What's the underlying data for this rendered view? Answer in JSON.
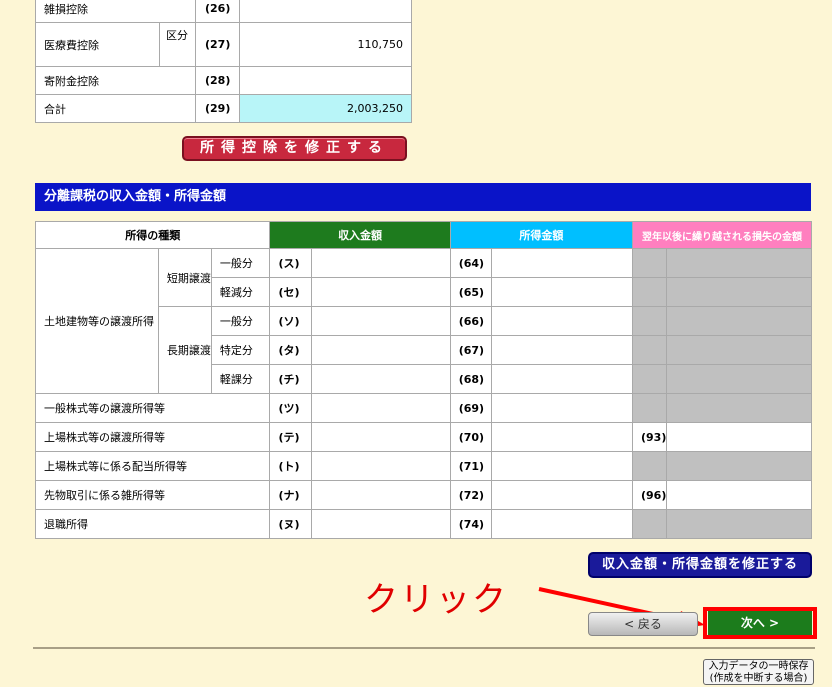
{
  "deductions": {
    "rows": [
      {
        "label": "雑損控除",
        "num": "(26)",
        "amount": ""
      },
      {
        "label": "医療費控除",
        "sub": "区分",
        "num": "(27)",
        "amount": "110,750"
      },
      {
        "label": "寄附金控除",
        "num": "(28)",
        "amount": ""
      },
      {
        "label": "合計",
        "num": "(29)",
        "amount": "2,003,250"
      }
    ],
    "modify_button": "所得控除を修正する"
  },
  "separate": {
    "title": "分離課税の収入金額・所得金額",
    "headers": {
      "kind": "所得の種類",
      "income": "収入金額",
      "shotoku": "所得金額",
      "loss": "翌年以後に繰り越される損失の金額"
    },
    "colors": {
      "income": "#1e7b1e",
      "shotoku": "#00bfff",
      "loss": "#ff7fbf"
    },
    "land": "土地建物等の譲渡所得",
    "short": "短期譲渡",
    "long": "長期譲渡",
    "rows": [
      {
        "sub": "一般分",
        "k": "(ス)",
        "n": "(64)",
        "loss_num": ""
      },
      {
        "sub": "軽減分",
        "k": "(セ)",
        "n": "(65)",
        "loss_num": ""
      },
      {
        "sub": "一般分",
        "k": "(ソ)",
        "n": "(66)",
        "loss_num": ""
      },
      {
        "sub": "特定分",
        "k": "(タ)",
        "n": "(67)",
        "loss_num": ""
      },
      {
        "sub": "軽課分",
        "k": "(チ)",
        "n": "(68)",
        "loss_num": ""
      },
      {
        "label": "一般株式等の譲渡所得等",
        "k": "(ツ)",
        "n": "(69)",
        "loss_num": ""
      },
      {
        "label": "上場株式等の譲渡所得等",
        "k": "(テ)",
        "n": "(70)",
        "loss_num": "(93)"
      },
      {
        "label": "上場株式等に係る配当所得等",
        "k": "(ト)",
        "n": "(71)",
        "loss_num": ""
      },
      {
        "label": "先物取引に係る雑所得等",
        "k": "(ナ)",
        "n": "(72)",
        "loss_num": "(96)"
      },
      {
        "label": "退職所得",
        "k": "(ヌ)",
        "n": "(74)",
        "loss_num": ""
      }
    ],
    "modify_button": "収入金額・所得金額を修正する"
  },
  "nav": {
    "back": "< 戻る",
    "next": "次へ >"
  },
  "save_button": {
    "line1": "入力データの一時保存",
    "line2": "(作成を中断する場合)"
  },
  "annotation": "クリック"
}
